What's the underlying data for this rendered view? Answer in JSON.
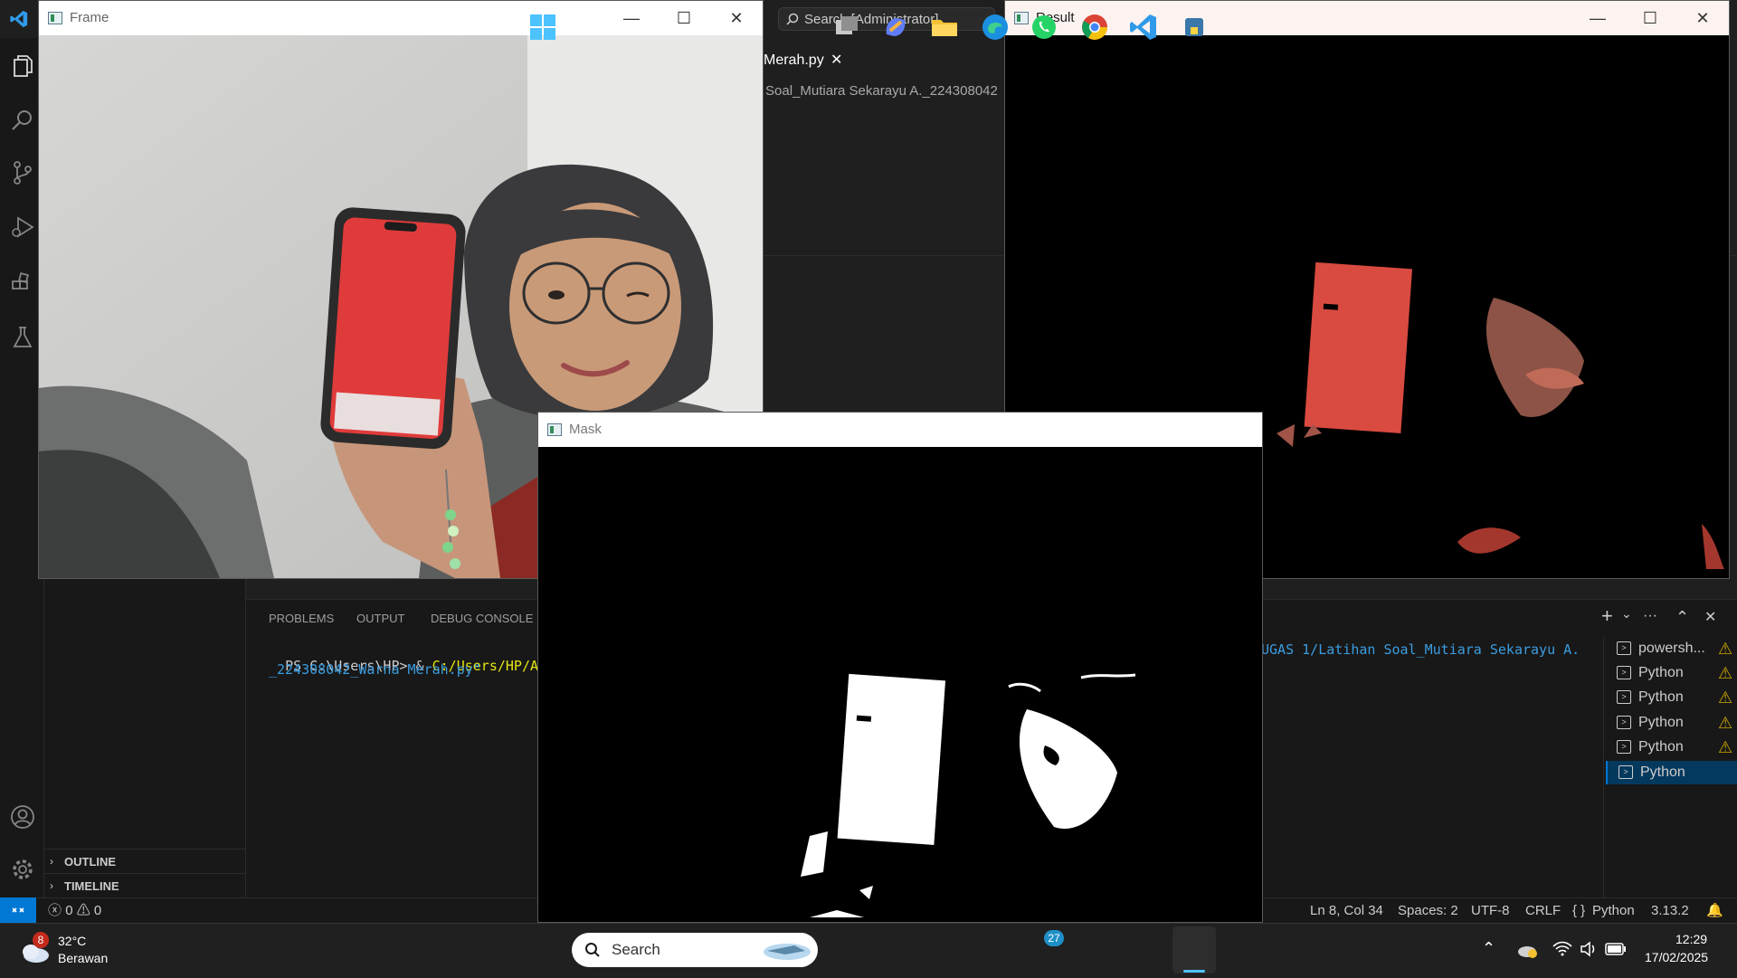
{
  "vscode": {
    "search_label": "Search [Administrator]",
    "tab": {
      "label": "Merah.py",
      "close": "✕"
    },
    "breadcrumb": "Soal_Mutiara Sekarayu A._224308042",
    "sidebar": {
      "outline": "OUTLINE",
      "timeline": "TIMELINE",
      "chevron": "›"
    },
    "panel": {
      "tabs": [
        "PROBLEMS",
        "OUTPUT",
        "DEBUG CONSOLE"
      ],
      "terminal": {
        "prompt": "PS C:\\Users\\HP> ",
        "amp": "& ",
        "python_path": "C:/Users/HP/App",
        "path_right": "UGAS 1/Latihan Soal_Mutiara Sekarayu A.",
        "line2": "_224308042_Warna Merah.py\""
      },
      "actions": {
        "add": "+",
        "dropdown": "⌄",
        "more": "···",
        "maximize": "⌃",
        "close": "✕"
      },
      "terminals": [
        {
          "label": "powersh...",
          "warning": true
        },
        {
          "label": "Python",
          "warning": true
        },
        {
          "label": "Python",
          "warning": true
        },
        {
          "label": "Python",
          "warning": true
        },
        {
          "label": "Python",
          "warning": true
        },
        {
          "label": "Python",
          "warning": false
        }
      ],
      "warn_glyph": "⚠"
    },
    "status": {
      "errors": "0",
      "warnings": "0",
      "position": "Ln 8, Col 34",
      "spaces": "Spaces: 2",
      "encoding": "UTF-8",
      "eol": "CRLF",
      "language": "Python",
      "version": "3.13.2",
      "lang_braces": "{ }"
    }
  },
  "windows": {
    "frame": {
      "title": "Frame"
    },
    "mask": {
      "title": "Mask"
    },
    "result": {
      "title": "Result"
    },
    "controls": {
      "minimize": "—",
      "maximize": "☐",
      "close": "✕"
    }
  },
  "taskbar": {
    "weather": {
      "temp": "32°C",
      "desc": "Berawan",
      "badge": "8"
    },
    "search_label": "Search",
    "whatsapp_badge": "27",
    "clock": {
      "time": "12:29",
      "date": "17/02/2025"
    }
  },
  "colors": {
    "accent": "#0078d4",
    "warning": "#cca700",
    "terminal_highlight": "#04395e",
    "phone_red": "#e03b3b"
  }
}
